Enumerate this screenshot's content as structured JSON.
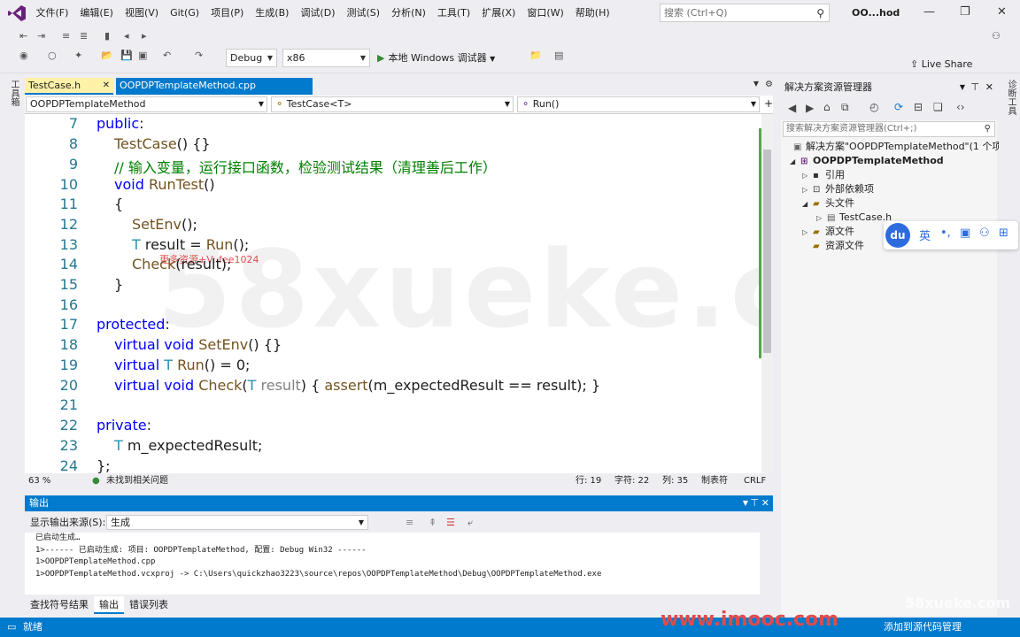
{
  "menubar": {
    "items": [
      "文件(F)",
      "编辑(E)",
      "视图(V)",
      "Git(G)",
      "项目(P)",
      "生成(B)",
      "调试(D)",
      "测试(S)",
      "分析(N)",
      "工具(T)",
      "扩展(X)",
      "窗口(W)",
      "帮助(H)"
    ],
    "search_placeholder": "搜索 (Ctrl+Q)",
    "solution_short": "OO...hod"
  },
  "toolbar": {
    "config": "Debug",
    "platform": "x86",
    "run_label": "本地 Windows 调试器",
    "live_share": "Live Share"
  },
  "left_tool": {
    "label": "工具箱"
  },
  "right_tool": {
    "label": "诊断工具"
  },
  "tabs": [
    {
      "label": "TestCase.h"
    },
    {
      "label": "OOPDPTemplateMethod.cpp"
    }
  ],
  "navbar": {
    "project": "OOPDPTemplateMethod",
    "scope": "TestCase<T>",
    "member": "Run()"
  },
  "code": {
    "line_numbers": [
      "7",
      "8",
      "9",
      "10",
      "11",
      "12",
      "13",
      "14",
      "15",
      "16",
      "17",
      "18",
      "19",
      "20",
      "21",
      "22",
      "23",
      "24"
    ],
    "watermark": "58xueke.com",
    "overlay_note": "更多资源+V: fee1024"
  },
  "status": {
    "zoom": "63 %",
    "issues": "未找到相关问题",
    "line": "行: 19",
    "char": "字符: 22",
    "col": "列: 35",
    "tabs": "制表符",
    "eol": "CRLF"
  },
  "output": {
    "title": "输出",
    "source_label": "显示输出来源(S):",
    "source_value": "生成",
    "lines": [
      "已启动生成…",
      "1>------ 已启动生成: 项目: OOPDPTemplateMethod, 配置: Debug Win32 ------",
      "1>OOPDPTemplateMethod.cpp",
      "1>OOPDPTemplateMethod.vcxproj -> C:\\Users\\quickzhao3223\\source\\repos\\OOPDPTemplateMethod\\Debug\\OOPDPTemplateMethod.exe"
    ],
    "tabs": [
      "查找符号结果",
      "输出",
      "错误列表"
    ]
  },
  "solution": {
    "title": "解决方案资源管理器",
    "search_placeholder": "搜索解决方案资源管理器(Ctrl+;)",
    "tree": [
      {
        "label": "解决方案\"OOPDPTemplateMethod\"(1 个项"
      },
      {
        "label": "OOPDPTemplateMethod"
      },
      {
        "label": "引用"
      },
      {
        "label": "外部依赖项"
      },
      {
        "label": "头文件"
      },
      {
        "label": "TestCase.h"
      },
      {
        "label": "源文件"
      },
      {
        "label": "资源文件"
      }
    ]
  },
  "ime": {
    "logo": "du",
    "lang": "英"
  },
  "bottom": {
    "ready": "就绪",
    "add_source": "添加到源代码管理"
  },
  "brand": {
    "url": "www.imooc.com",
    "watermark": "58xueke.com"
  }
}
